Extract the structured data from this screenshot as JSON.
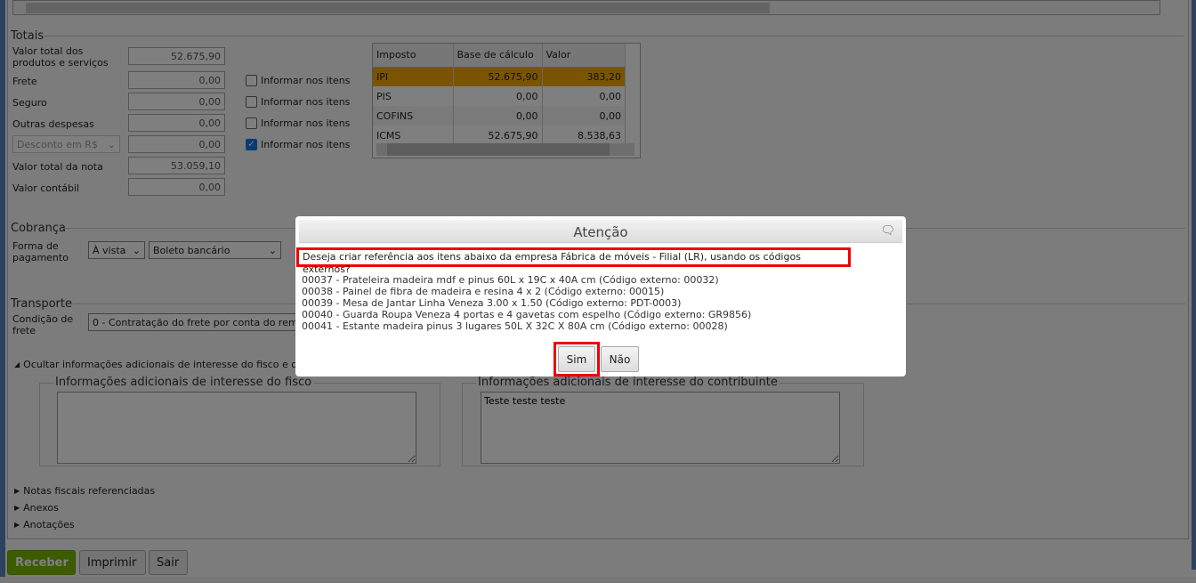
{
  "totais": {
    "title": "Totais",
    "rows": [
      {
        "label": "Valor total dos produtos e serviços",
        "value": "52.675,90"
      },
      {
        "label": "Frete",
        "value": "0,00",
        "check": "Informar nos itens",
        "checked": false
      },
      {
        "label": "Seguro",
        "value": "0,00",
        "check": "Informar nos itens",
        "checked": false
      },
      {
        "label": "Outras despesas",
        "value": "0,00",
        "check": "Informar nos itens",
        "checked": false
      },
      {
        "label": "Desconto em R$",
        "value": "0,00",
        "check": "Informar nos itens",
        "checked": true
      },
      {
        "label": "Valor total da nota",
        "value": "53.059,10"
      },
      {
        "label": "Valor contábil",
        "value": "0,00"
      }
    ]
  },
  "impostos": {
    "headers": [
      "Imposto",
      "Base de cálculo",
      "Valor"
    ],
    "rows": [
      [
        "IPI",
        "52.675,90",
        "383,20"
      ],
      [
        "PIS",
        "0,00",
        "0,00"
      ],
      [
        "COFINS",
        "0,00",
        "0,00"
      ],
      [
        "ICMS",
        "52.675,90",
        "8.538,63"
      ]
    ],
    "highlight_color": "#f5a800"
  },
  "cobranca": {
    "title": "Cobrança",
    "label": "Forma de pagamento",
    "condicao": "À vista",
    "forma": "Boleto bancário"
  },
  "transporte": {
    "title": "Transporte",
    "label": "Condição de frete",
    "value": "0 - Contratação do frete por conta do rem"
  },
  "info": {
    "toggle": "Ocultar informações adicionais de interesse do fisco e do",
    "fisco_title": "Informações adicionais de interesse do fisco",
    "fisco_value": "",
    "contrib_title": "Informações adicionais de interesse do contribuinte",
    "contrib_value": "Teste teste teste"
  },
  "sections": [
    "Notas fiscais referenciadas",
    "Anexos",
    "Anotações"
  ],
  "buttons": {
    "receber": "Receber",
    "imprimir": "Imprimir",
    "sair": "Sair"
  },
  "dialog": {
    "title": "Atenção",
    "question": "Deseja criar referência aos itens abaixo da empresa Fábrica de móveis - Filial (LR), usando os códigos externos?",
    "items": [
      "00037 - Prateleira madeira mdf e pinus 60L x 19C x 40A cm (Código externo: 00032)",
      "00038 - Painel de fibra de madeira e resina 4 x 2 (Código externo: 00015)",
      "00039 - Mesa de Jantar Linha Veneza 3.00 x 1.50 (Código externo: PDT-0003)",
      "00040 - Guarda Roupa Veneza 4 portas e 4 gavetas com espelho (Código externo: GR9856)",
      "00041 - Estante madeira pinus 3 lugares 50L X 32C X 80A cm (Código externo: 00028)"
    ],
    "yes": "Sim",
    "no": "Não"
  }
}
